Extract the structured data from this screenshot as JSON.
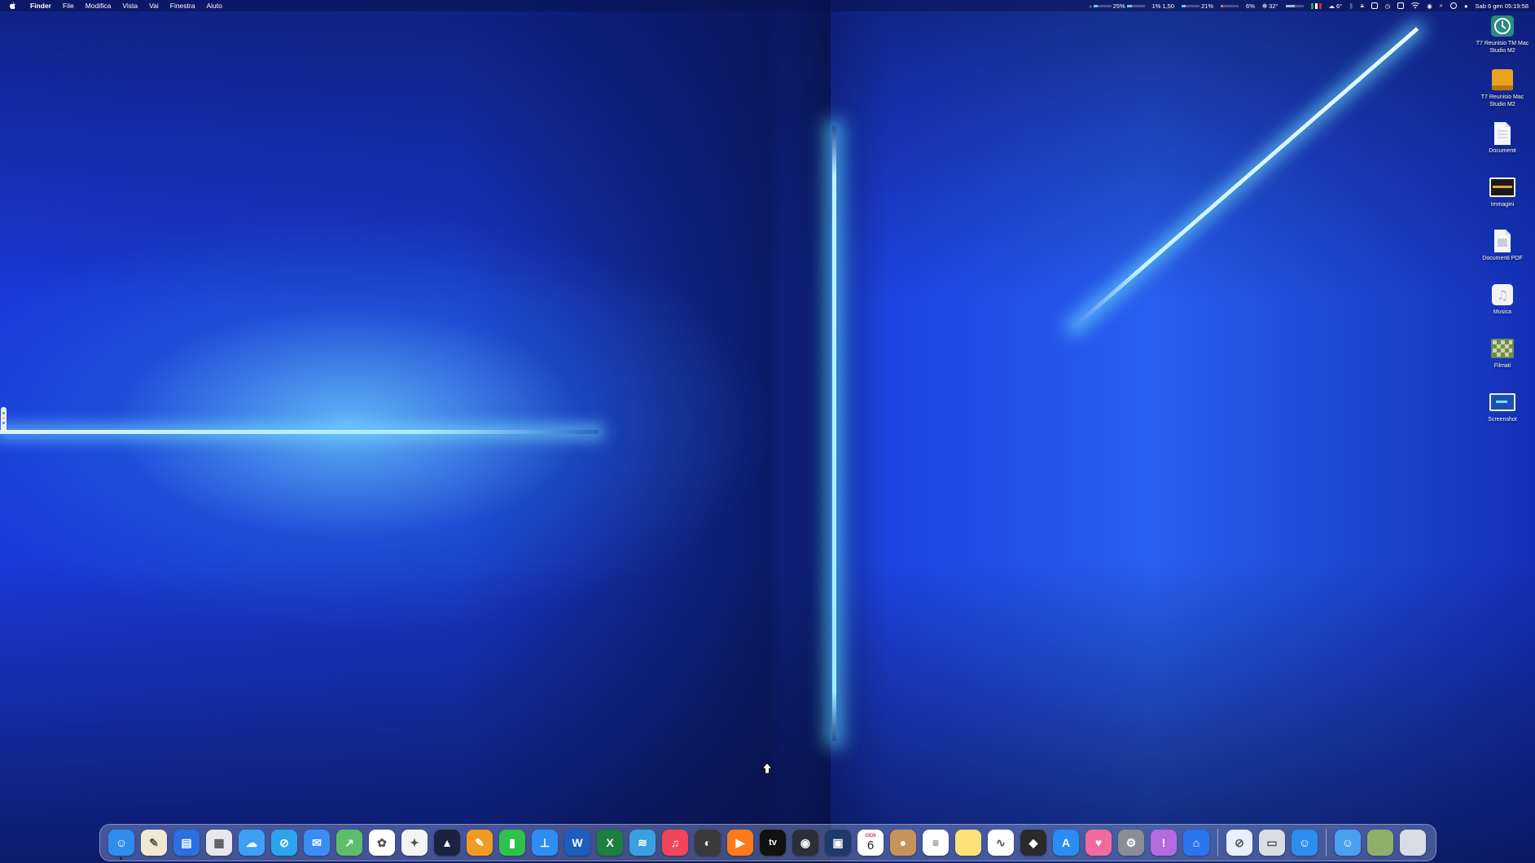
{
  "menubar": {
    "apple_icon": "apple-logo-icon",
    "app_name": "Finder",
    "items": [
      "File",
      "Modifica",
      "Vista",
      "Vai",
      "Finestra",
      "Aiuto"
    ],
    "status": {
      "cpu_percent": "25%",
      "cpu_usage": 0.25,
      "load_a": "1%",
      "load_b": "1,50",
      "memory_percent": "21%",
      "memory_usage": 0.21,
      "disk_percent": "6%",
      "temperature": "32°",
      "weather_temp": "6°",
      "datetime": "Sab 6 gen  05:19:58"
    }
  },
  "desktop_icons": [
    {
      "label": "T7 Reunisio TM Mac Studio M2",
      "icon": "time-machine-disk-icon"
    },
    {
      "label": "T7 Reunisio Mac Studio M2",
      "icon": "external-drive-icon"
    },
    {
      "label": "Documenti",
      "icon": "document-icon"
    },
    {
      "label": "Immagini",
      "icon": "images-folder-icon"
    },
    {
      "label": "Documenti PDF",
      "icon": "pdf-document-icon"
    },
    {
      "label": "Musica",
      "icon": "music-file-icon"
    },
    {
      "label": "Filmati",
      "icon": "movies-folder-icon"
    },
    {
      "label": "Screenshot",
      "icon": "screenshot-icon"
    }
  ],
  "dock": {
    "calendar_month": "GEN",
    "calendar_day": "6",
    "tv_label": "tv",
    "apps": [
      {
        "name": "finder",
        "color": "#2f8df0"
      },
      {
        "name": "pages-style",
        "color": "#f1e7d2"
      },
      {
        "name": "files",
        "color": "#2b6fe0"
      },
      {
        "name": "launchpad",
        "color": "#e8e8ee"
      },
      {
        "name": "icloud",
        "color": "#3ea0f5"
      },
      {
        "name": "safari",
        "color": "#2aa5ee"
      },
      {
        "name": "mail",
        "color": "#3a8df5"
      },
      {
        "name": "maps",
        "color": "#5ebd6a"
      },
      {
        "name": "photos",
        "color": "#ffffff"
      },
      {
        "name": "pixelmator",
        "color": "#f4f4f4"
      },
      {
        "name": "affinity",
        "color": "#1c2340"
      },
      {
        "name": "pages",
        "color": "#f39a22"
      },
      {
        "name": "numbers",
        "color": "#2fc14b"
      },
      {
        "name": "keynote",
        "color": "#2d8ef2"
      },
      {
        "name": "word",
        "color": "#1f5cbf"
      },
      {
        "name": "excel",
        "color": "#1a7f3f"
      },
      {
        "name": "layers",
        "color": "#3a9fe0"
      },
      {
        "name": "music",
        "color": "#f24559"
      },
      {
        "name": "darkroom",
        "color": "#3a3a3a"
      },
      {
        "name": "infuse",
        "color": "#ff7a1c"
      },
      {
        "name": "apple-tv",
        "color": "#111111"
      },
      {
        "name": "camera",
        "color": "#2a2f38"
      },
      {
        "name": "zoom-like",
        "color": "#1e3a6a"
      },
      {
        "name": "calendar",
        "color": "#ffffff"
      },
      {
        "name": "contacts",
        "color": "#c8935a"
      },
      {
        "name": "reminders",
        "color": "#ffffff"
      },
      {
        "name": "notes",
        "color": "#fde27a"
      },
      {
        "name": "freeform",
        "color": "#ffffff"
      },
      {
        "name": "altstore",
        "color": "#2a2a2a"
      },
      {
        "name": "app-store",
        "color": "#2a8df5"
      },
      {
        "name": "clean-app",
        "color": "#f06aa0"
      },
      {
        "name": "system-settings",
        "color": "#8a8d93"
      },
      {
        "name": "speeko",
        "color": "#b56ae0"
      },
      {
        "name": "artstudio",
        "color": "#2a75f0"
      },
      {
        "name": "separator",
        "color": ""
      },
      {
        "name": "safari-tech",
        "color": "#e6f0ff"
      },
      {
        "name": "preview",
        "color": "#d9dde4"
      },
      {
        "name": "finder-folder",
        "color": "#2f8df0"
      },
      {
        "name": "separator",
        "color": ""
      },
      {
        "name": "downloads-finder",
        "color": "#4aa0f0"
      },
      {
        "name": "movie-thumb",
        "color": "#8fae6a"
      },
      {
        "name": "trash",
        "color": "#d7dde6"
      }
    ]
  }
}
